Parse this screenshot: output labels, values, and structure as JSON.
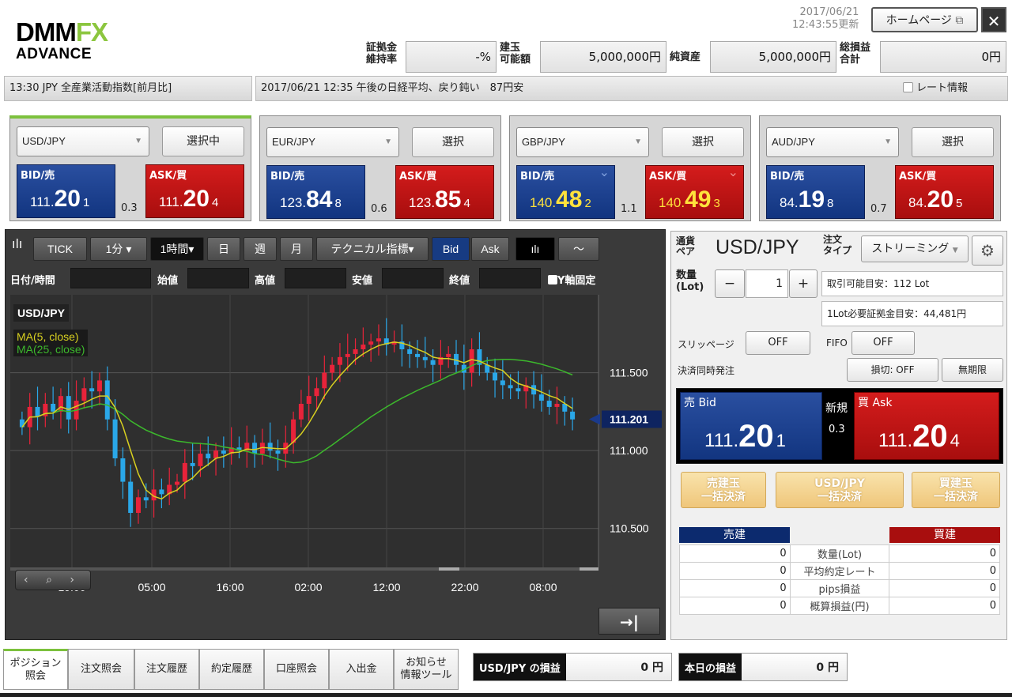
{
  "header": {
    "logo_top": "DMM",
    "logo_fx": "FX",
    "logo_bottom": "ADVANCE",
    "update_date": "2017/06/21",
    "update_time": "12:43:55更新",
    "homepage_label": "ホームページ",
    "close_label": "✕",
    "margin_ratio_label1": "証拠金",
    "margin_ratio_label2": "維持率",
    "margin_ratio_value": "-%",
    "position_capacity_label1": "建玉",
    "position_capacity_label2": "可能額",
    "position_capacity_value": "5,000,000円",
    "net_assets_label": "純資産",
    "net_assets_value": "5,000,000円",
    "total_pl_label1": "総損益",
    "total_pl_label2": "合計",
    "total_pl_value": "0円"
  },
  "news": {
    "left": "13:30  JPY  全産業活動指数[前月比]",
    "right": "2017/06/21 12:35 午後の日経平均、戻り鈍い　87円安",
    "rate_info_label": "レート情報"
  },
  "pairs": [
    {
      "symbol": "USD/JPY",
      "select_label": "選択中",
      "bid_label": "BID/売",
      "ask_label": "ASK/買",
      "bid_a": "111.",
      "bid_b": "20",
      "bid_c": "1",
      "ask_a": "111.",
      "ask_b": "20",
      "ask_c": "4",
      "spread": "0.3",
      "active": true
    },
    {
      "symbol": "EUR/JPY",
      "select_label": "選択",
      "bid_label": "BID/売",
      "ask_label": "ASK/買",
      "bid_a": "123.",
      "bid_b": "84",
      "bid_c": "8",
      "ask_a": "123.",
      "ask_b": "85",
      "ask_c": "4",
      "spread": "0.6",
      "active": false
    },
    {
      "symbol": "GBP/JPY",
      "select_label": "選択",
      "bid_label": "BID/売",
      "ask_label": "ASK/買",
      "bid_a": "140.",
      "bid_b": "48",
      "bid_c": "2",
      "ask_a": "140.",
      "ask_b": "49",
      "ask_c": "3",
      "spread": "1.1",
      "active": false,
      "highlight": true
    },
    {
      "symbol": "AUD/JPY",
      "select_label": "選択",
      "bid_label": "BID/売",
      "ask_label": "ASK/買",
      "bid_a": "84.",
      "bid_b": "19",
      "bid_c": "8",
      "ask_a": "84.",
      "ask_b": "20",
      "ask_c": "5",
      "spread": "0.7",
      "active": false
    }
  ],
  "chart_toolbar": {
    "tick": "TICK",
    "minute": "1分 ▾",
    "hour": "1時間▾",
    "day": "日",
    "week": "週",
    "month": "月",
    "technical": "テクニカル指標▾",
    "bid": "Bid",
    "ask": "Ask"
  },
  "chart_fields": {
    "datetime": "日付/時間",
    "open": "始値",
    "high": "高値",
    "low": "安値",
    "close": "終値",
    "y_fixed": "Y軸固定"
  },
  "chart_data": {
    "type": "candlestick",
    "symbol": "USD/JPY",
    "legend": [
      "MA(5, close)",
      "MA(25, close)"
    ],
    "y_ticks": [
      "111.500",
      "111.000",
      "110.500"
    ],
    "y_range": [
      110.25,
      112.0
    ],
    "current_price": "111.201",
    "x_ticks": [
      "19:00",
      "05:00",
      "16:00",
      "02:00",
      "12:00",
      "22:00",
      "08:00"
    ],
    "series_colors": {
      "ma5": "#d8d020",
      "ma25": "#3cb82c",
      "up": "#e8233a",
      "down": "#2aa7e8"
    },
    "closes": [
      111.15,
      111.28,
      111.22,
      111.3,
      111.25,
      111.35,
      111.2,
      111.32,
      111.4,
      111.38,
      111.45,
      111.2,
      110.95,
      110.8,
      110.6,
      110.7,
      110.68,
      110.75,
      110.72,
      110.78,
      110.8,
      110.92,
      110.9,
      110.98,
      110.95,
      111.0,
      110.98,
      111.02,
      111.0,
      111.05,
      110.98,
      111.05,
      111.0,
      110.98,
      111.05,
      111.2,
      111.3,
      111.35,
      111.4,
      111.5,
      111.55,
      111.6,
      111.62,
      111.65,
      111.68,
      111.7,
      111.72,
      111.68,
      111.7,
      111.65,
      111.62,
      111.6,
      111.58,
      111.55,
      111.6,
      111.62,
      111.55,
      111.5,
      111.65,
      111.55,
      111.5,
      111.45,
      111.42,
      111.4,
      111.38,
      111.42,
      111.36,
      111.32,
      111.28,
      111.3,
      111.25,
      111.2
    ]
  },
  "order": {
    "pair_label1": "通貨",
    "pair_label2": "ペア",
    "pair": "USD/JPY",
    "type_label1": "注文",
    "type_label2": "タイプ",
    "type_value": "ストリーミング",
    "qty_label1": "数量",
    "qty_label2": "(Lot)",
    "qty_minus": "−",
    "qty_value": "1",
    "qty_plus": "+",
    "tradable": "取引可能目安：112 Lot",
    "margin_per_lot": "1Lot必要証拠金目安：44,481円",
    "slippage_label": "スリッページ",
    "slippage_value": "OFF",
    "fifo_label": "FIFO",
    "fifo_value": "OFF",
    "simultaneous_label": "決済同時発注",
    "stoploss": "損切: OFF",
    "unlimited": "無期限",
    "sell_label": "売 Bid",
    "buy_label": "買 Ask",
    "new_label": "新規",
    "spread": "0.3",
    "sell_a": "111.",
    "sell_b": "20",
    "sell_c": "1",
    "buy_a": "111.",
    "buy_b": "20",
    "buy_c": "4",
    "bulk_sell": "売建玉\n一括決済",
    "bulk_pair": "USD/JPY\n一括決済",
    "bulk_buy": "買建玉\n一括決済",
    "table_sell_header": "売建",
    "table_buy_header": "買建",
    "rows": [
      {
        "label": "数量(Lot)",
        "sell": "0",
        "buy": "0"
      },
      {
        "label": "平均約定レート",
        "sell": "0",
        "buy": "0"
      },
      {
        "label": "pips損益",
        "sell": "0",
        "buy": "0"
      },
      {
        "label": "概算損益(円)",
        "sell": "0",
        "buy": "0"
      }
    ]
  },
  "bottom": {
    "tabs": [
      "ポジション\n照会",
      "注文照会",
      "注文履歴",
      "約定履歴",
      "口座照会",
      "入出金",
      "お知らせ\n情報ツール"
    ],
    "pair_pl_label": "USD/JPY の損益",
    "pair_pl_value": "0 円",
    "today_pl_label": "本日の損益",
    "today_pl_value": "0 円"
  }
}
